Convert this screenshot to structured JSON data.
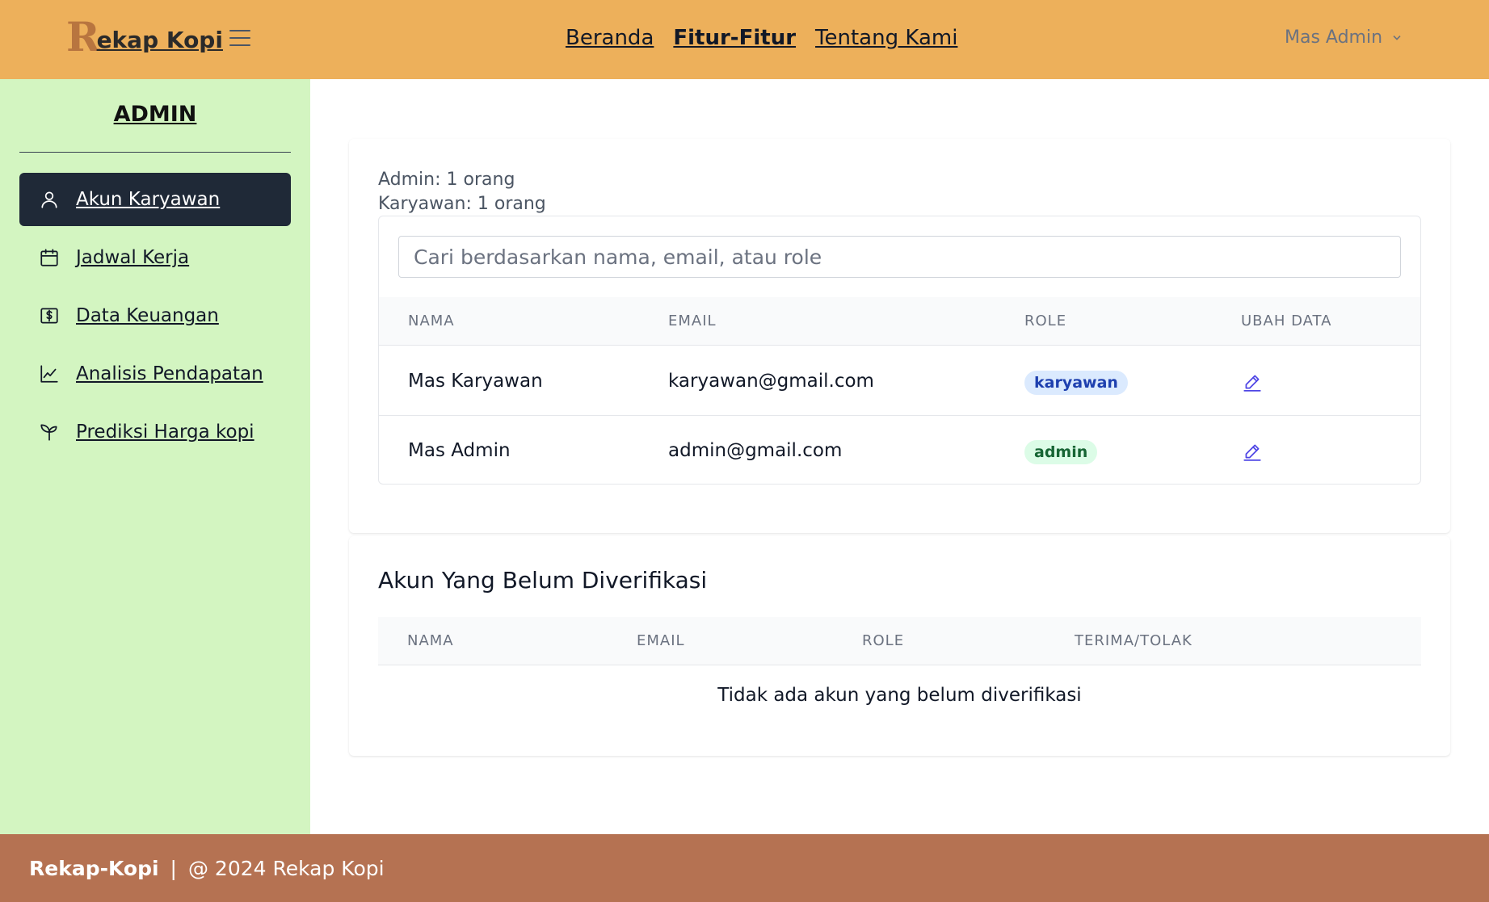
{
  "header": {
    "logo_letter": "R",
    "logo_text": "ekap Kopi",
    "nav": [
      "Beranda",
      "Fitur-Fitur",
      "Tentang Kami"
    ],
    "user": "Mas Admin"
  },
  "sidebar": {
    "title": "ADMIN",
    "items": [
      {
        "label": "Akun Karyawan",
        "icon": "user-icon"
      },
      {
        "label": "Jadwal Kerja",
        "icon": "calendar-icon"
      },
      {
        "label": "Data Keuangan",
        "icon": "dollar-bill-icon"
      },
      {
        "label": "Analisis Pendapatan",
        "icon": "line-chart-icon"
      },
      {
        "label": "Prediksi Harga kopi",
        "icon": "sprout-icon"
      }
    ]
  },
  "summary": {
    "admin_count": "Admin: 1 orang",
    "karyawan_count": "Karyawan: 1 orang"
  },
  "search": {
    "placeholder": "Cari berdasarkan nama, email, atau role"
  },
  "users_table": {
    "headers": [
      "NAMA",
      "EMAIL",
      "ROLE",
      "UBAH DATA"
    ],
    "rows": [
      {
        "nama": "Mas Karyawan",
        "email": "karyawan@gmail.com",
        "role": "karyawan"
      },
      {
        "nama": "Mas Admin",
        "email": "admin@gmail.com",
        "role": "admin"
      }
    ]
  },
  "pending": {
    "title": "Akun Yang Belum Diverifikasi",
    "headers": [
      "NAMA",
      "EMAIL",
      "ROLE",
      "TERIMA/TOLAK"
    ],
    "empty_message": "Tidak ada akun yang belum diverifikasi"
  },
  "footer": {
    "brand": "Rekap-Kopi",
    "separator": "|",
    "copyright": "@ 2024 Rekap Kopi"
  },
  "colors": {
    "header": "#edb05b",
    "sidebar": "#d3f5c1",
    "active_item": "#1f2937",
    "footer": "#b57252",
    "edit_icon": "#4f46e5"
  }
}
